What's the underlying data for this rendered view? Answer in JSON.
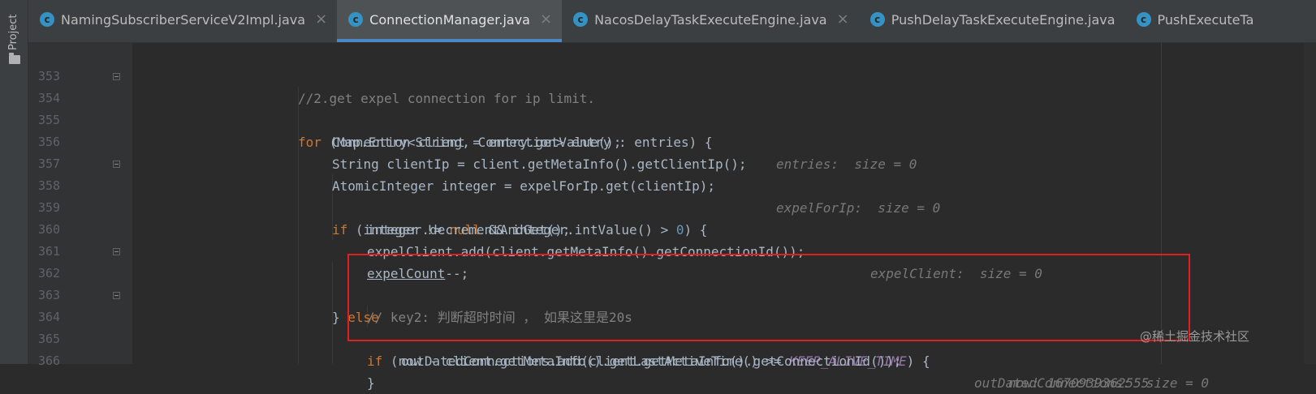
{
  "sidebar": {
    "label": "Project",
    "icon": "folder-icon"
  },
  "tabs": [
    {
      "icon_letter": "c",
      "label": "NamingSubscriberServiceV2Impl.java",
      "close": "×",
      "active": false
    },
    {
      "icon_letter": "c",
      "label": "ConnectionManager.java",
      "close": "×",
      "active": true
    },
    {
      "icon_letter": "c",
      "label": "NacosDelayTaskExecuteEngine.java",
      "close": "×",
      "active": false
    },
    {
      "icon_letter": "c",
      "label": "PushDelayTaskExecuteEngine.java",
      "close": "",
      "active": false
    },
    {
      "icon_letter": "c",
      "label": "PushExecuteTa",
      "close": "",
      "active": false
    }
  ],
  "lines": [
    {
      "num": "353",
      "code": "//2.get expel connection for ip limit."
    },
    {
      "num": "354",
      "code": "for (Map.Entry<String, Connection> entry : entries) {",
      "hint": "entries:  size = 0"
    },
    {
      "num": "355",
      "code": "Connection client = entry.getValue();"
    },
    {
      "num": "356",
      "code": "String clientIp = client.getMetaInfo().getClientIp();"
    },
    {
      "num": "357",
      "code": "AtomicInteger integer = expelForIp.get(clientIp);",
      "hint": "expelForIp:  size = 0"
    },
    {
      "num": "358",
      "code": "if (integer != null && integer.intValue() > 0) {"
    },
    {
      "num": "359",
      "code": "integer.decrementAndGet();"
    },
    {
      "num": "360",
      "code": "expelClient.add(client.getMetaInfo().getConnectionId());",
      "hint": "expelClient:  size = 0"
    },
    {
      "num": "361",
      "code": "expelCount--;"
    },
    {
      "num": "362",
      "code": "} else"
    },
    {
      "num": "363",
      "code": "// key2: 判断超时时间 ， 如果这里是20s"
    },
    {
      "num": "364",
      "code": "if (now - client.getMetaInfo().getLastActiveTime() >= KEEP_ALIVE_TIME) {",
      "hint": "now: 1670939362555"
    },
    {
      "num": "365",
      "code": "outDatedConnections.add(client.getMetaInfo().getConnectionId());",
      "hint": "outDatedConnections:  size = 0"
    },
    {
      "num": "366",
      "code": "}"
    }
  ],
  "tokens": {
    "l353": {
      "comment": "//2.get expel connection for ip limit."
    },
    "l354": {
      "kw": "for",
      "rest": " (Map.Entry<String, Connection> entry : entries) {"
    },
    "l358": {
      "kw": "if",
      "a": " (integer != ",
      "kw2": "null",
      "b": " && integer.intValue() > ",
      "num": "0",
      "c": ") {"
    },
    "l360": {
      "code": "expelClient.add(client.getMetaInfo().getConnectionId());"
    },
    "l361": {
      "ul": "expelCount",
      "rest": "--;"
    },
    "l362": {
      "a": "} ",
      "kw": "else"
    },
    "l363": {
      "comment": "// key2: 判断超时时间 ， 如果这里是20s"
    },
    "l364": {
      "kw": "if",
      "a": " (now - client.getMetaInfo().getLastActiveTime() >= ",
      "cst": "KEEP_ALIVE_TIME",
      "b": ") {"
    }
  },
  "watermark": "@稀土掘金技术社区"
}
